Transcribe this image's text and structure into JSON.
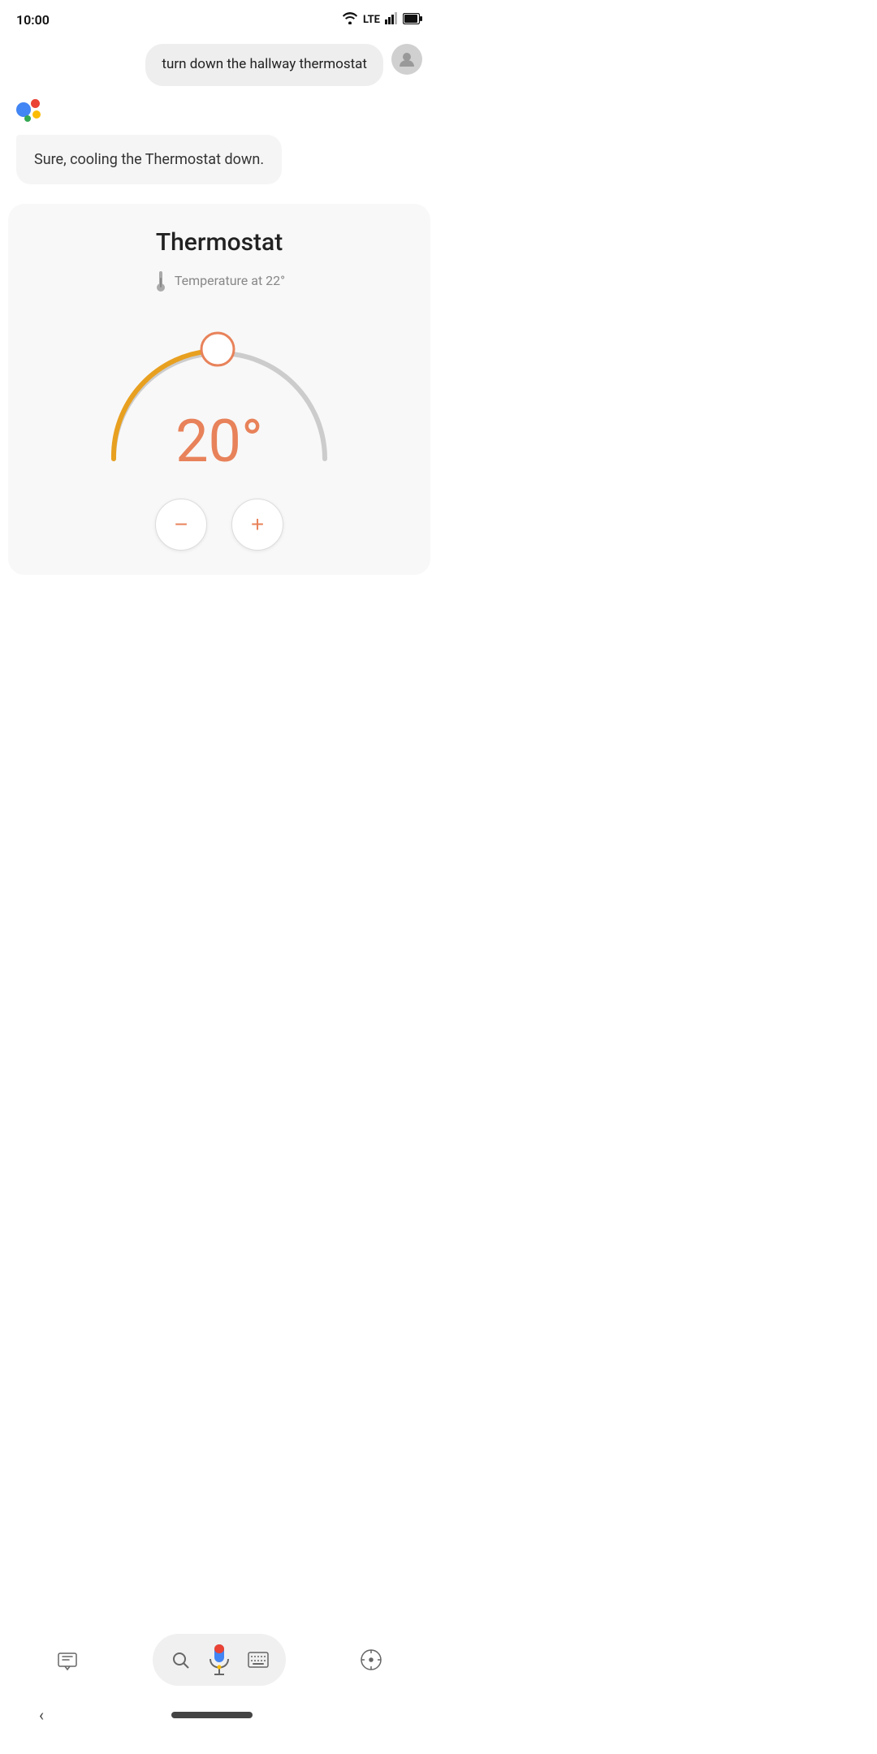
{
  "status": {
    "time": "10:00",
    "lte": "LTE"
  },
  "user_message": {
    "text": "turn down the hallway thermostat"
  },
  "assistant_message": {
    "text": "Sure, cooling the Thermostat down."
  },
  "thermostat": {
    "title": "Thermostat",
    "temperature_label": "Temperature at 22°",
    "current_temp": "20°",
    "colors": {
      "active_arc": "#E8A020",
      "inactive_arc": "#CCCCCC",
      "handle": "#E8825A",
      "temp_text": "#E8825A"
    },
    "minus_label": "−",
    "plus_label": "+"
  },
  "bottom_bar": {
    "icons": [
      "assistant-icon",
      "lens-icon",
      "mic-icon",
      "keyboard-icon",
      "compass-icon"
    ]
  }
}
